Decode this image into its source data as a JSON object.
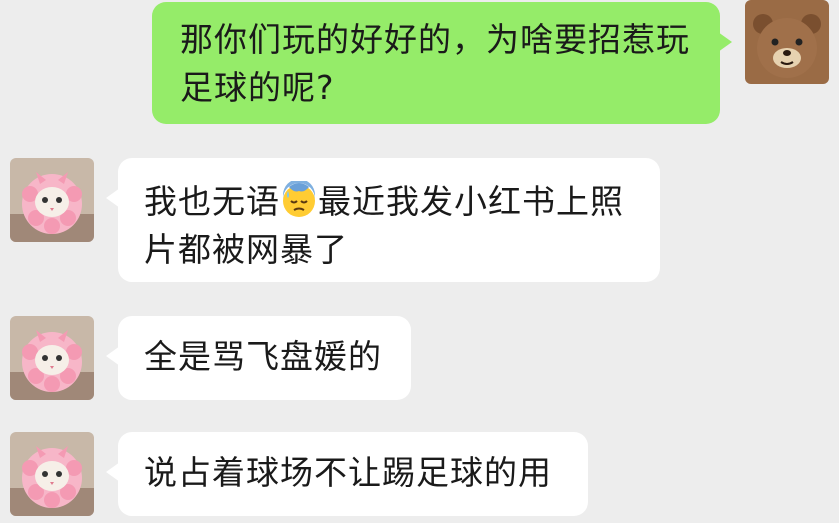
{
  "messages": [
    {
      "sender": "self",
      "avatar": "bear-avatar",
      "text": "那你们玩的好好的，为啥要招惹玩足球的呢?"
    },
    {
      "sender": "other",
      "avatar": "cat-avatar",
      "text_before_emoji": "我也无语",
      "emoji": "cold-sweat-emoji",
      "text_after_emoji": "最近我发小红书上照片都被网暴了"
    },
    {
      "sender": "other",
      "avatar": "cat-avatar",
      "text": "全是骂飞盘媛的"
    },
    {
      "sender": "other",
      "avatar": "cat-avatar",
      "text": "说占着球场不让踢足球的用"
    }
  ],
  "colors": {
    "background": "#ededed",
    "self_bubble": "#95ec69",
    "other_bubble": "#ffffff"
  }
}
